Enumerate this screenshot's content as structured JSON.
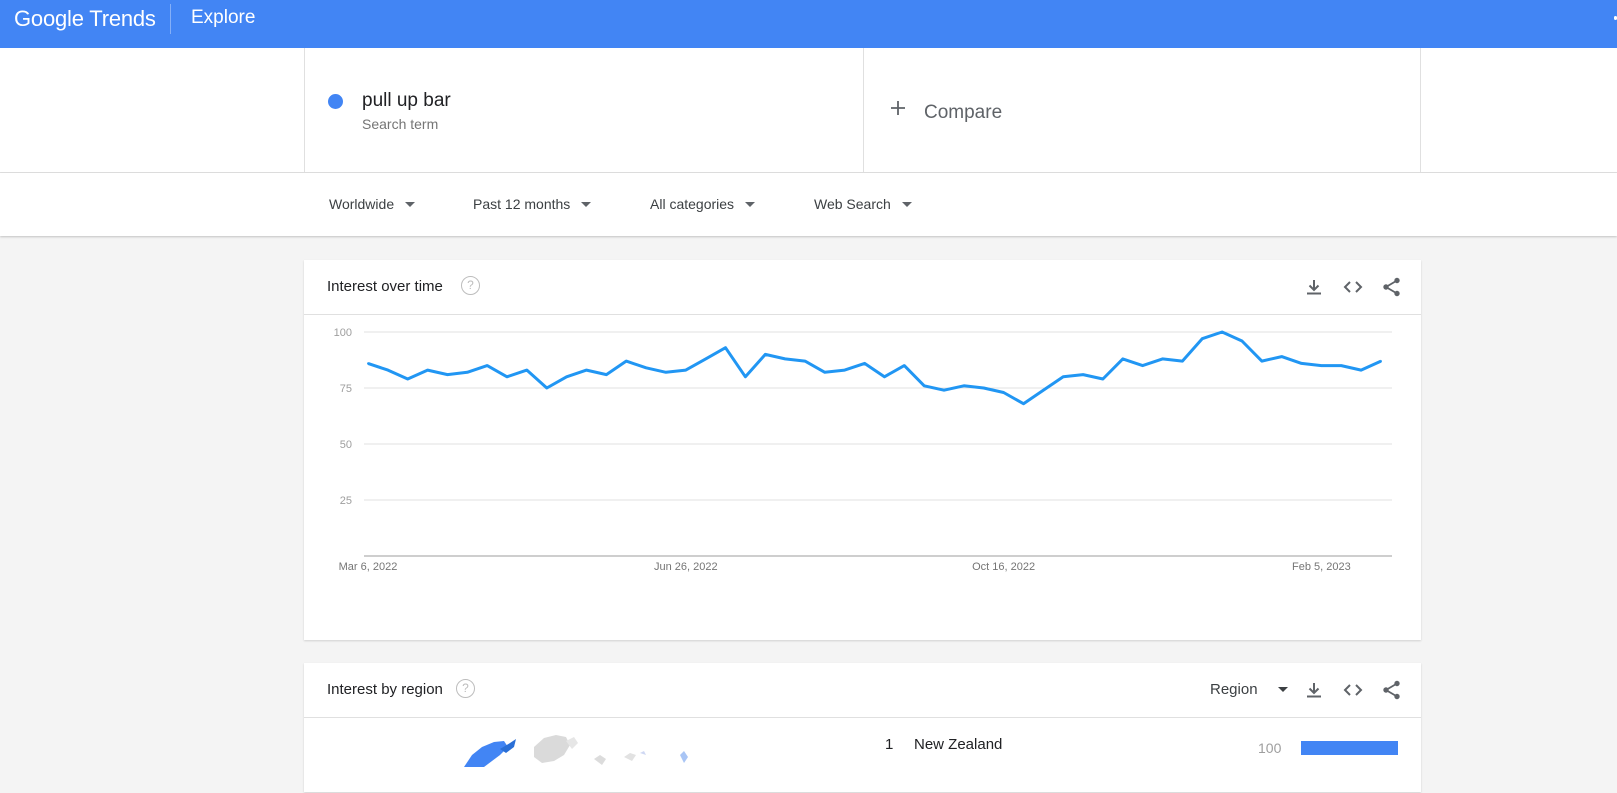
{
  "header": {
    "logo_google": "Google",
    "logo_trends": "Trends",
    "nav_title": "Explore"
  },
  "search": {
    "term": "pull up bar",
    "term_type": "Search term",
    "term_color": "#4285f4",
    "compare_icon": "plus-icon",
    "compare_label": "Compare"
  },
  "filters": [
    {
      "label": "Worldwide",
      "icon": "caret-down-icon"
    },
    {
      "label": "Past 12 months",
      "icon": "caret-down-icon"
    },
    {
      "label": "All categories",
      "icon": "caret-down-icon"
    },
    {
      "label": "Web Search",
      "icon": "caret-down-icon"
    }
  ],
  "interest_over_time": {
    "title": "Interest over time",
    "help_icon": "help-icon",
    "actions": [
      "download-icon",
      "embed-icon",
      "share-icon"
    ]
  },
  "chart_data": {
    "type": "line",
    "title": "",
    "xlabel": "",
    "ylabel": "",
    "ylim": [
      0,
      100
    ],
    "yticks": [
      25,
      50,
      75,
      100
    ],
    "xtick_labels": [
      "Mar 6, 2022",
      "Jun 26, 2022",
      "Oct 16, 2022",
      "Feb 5, 2023"
    ],
    "xtick_indices": [
      0,
      16,
      32,
      48
    ],
    "grid": true,
    "line_color": "#2196f3",
    "series": [
      {
        "values": [
          86,
          83,
          79,
          83,
          81,
          82,
          85,
          80,
          83,
          75,
          80,
          83,
          81,
          87,
          84,
          82,
          83,
          88,
          93,
          80,
          90,
          88,
          87,
          82,
          83,
          86,
          80,
          85,
          76,
          74,
          76,
          75,
          73,
          68,
          74,
          80,
          81,
          79,
          88,
          85,
          88,
          87,
          97,
          100,
          96,
          87,
          89,
          86,
          85,
          85,
          83,
          87
        ]
      }
    ]
  },
  "interest_by_region": {
    "title": "Interest by region",
    "help_icon": "help-icon",
    "resolution": "Region",
    "actions": [
      "download-icon",
      "embed-icon",
      "share-icon"
    ],
    "rows": [
      {
        "rank": "1",
        "name": "New Zealand",
        "value": "100",
        "fill": 1.0
      }
    ]
  }
}
